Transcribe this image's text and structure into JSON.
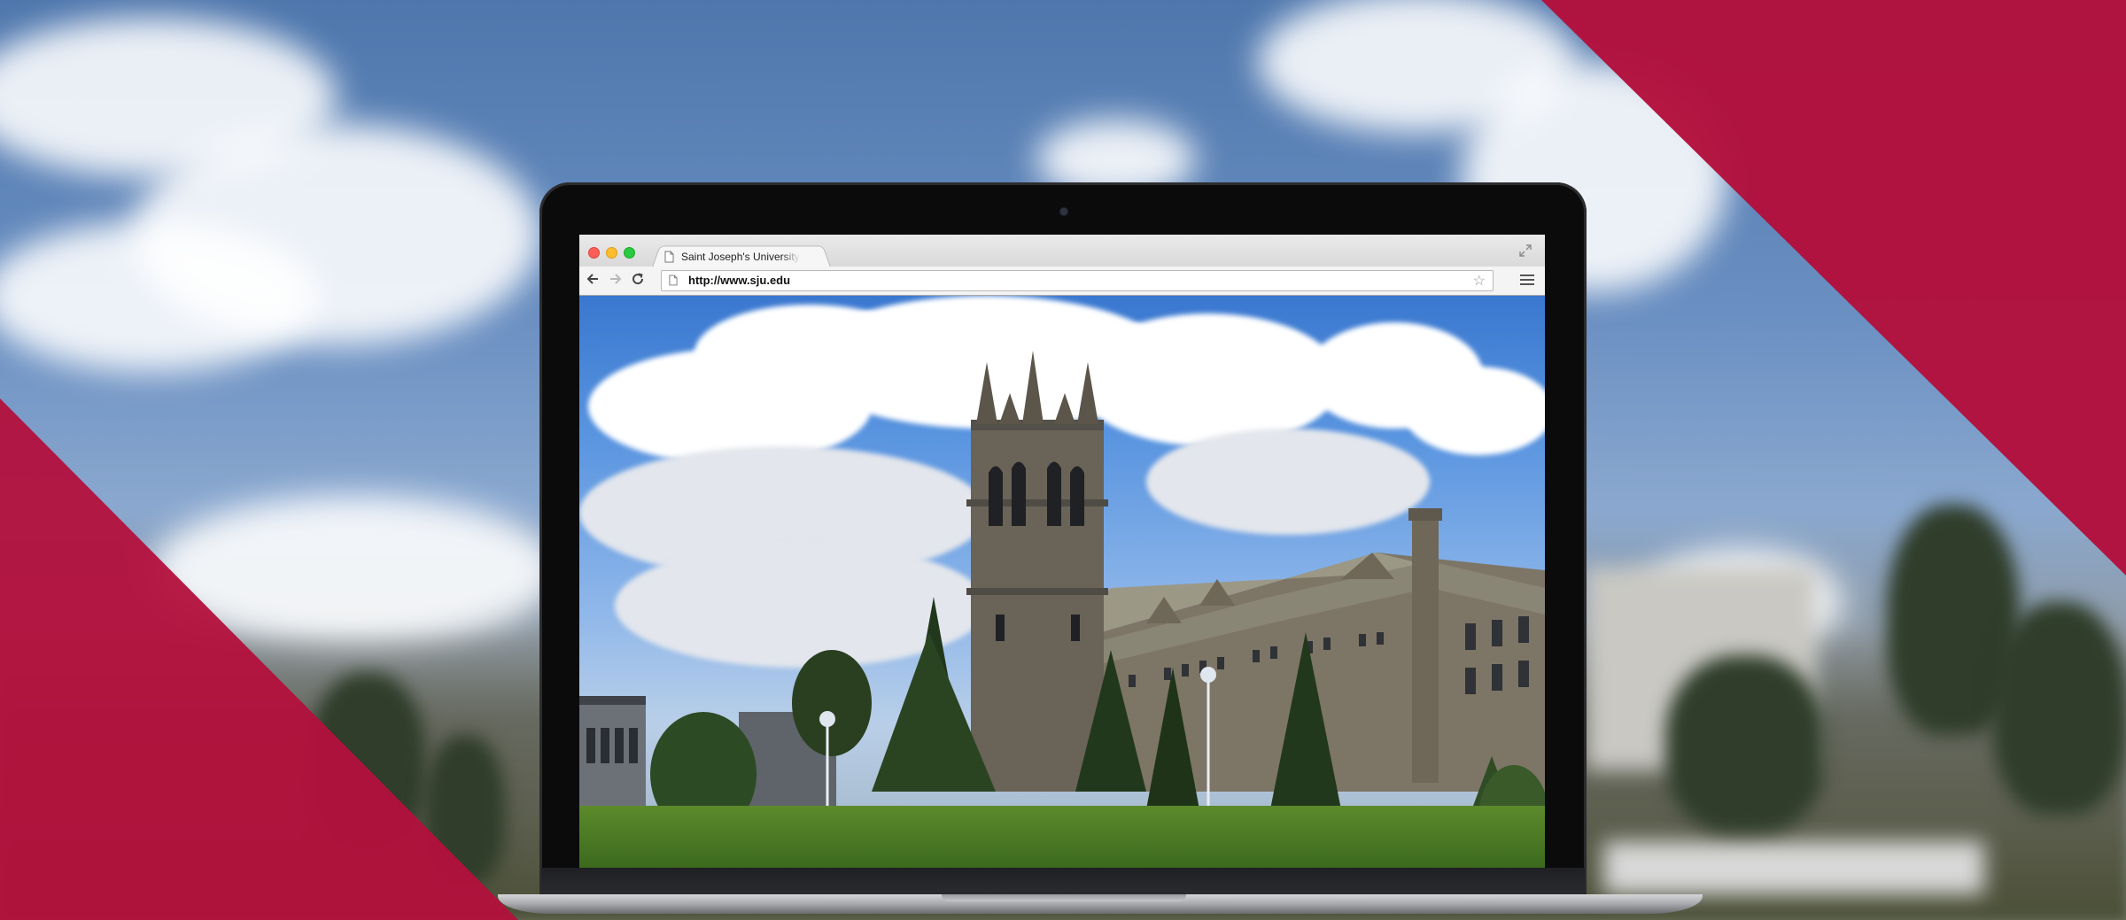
{
  "browser": {
    "tab_title": "Saint Joseph's University",
    "url": "http://www.sju.edu",
    "icons": {
      "close": "traffic-close-icon",
      "minimize": "traffic-minimize-icon",
      "zoom": "traffic-zoom-icon",
      "tab_page": "page-icon",
      "fullscreen": "fullscreen-icon",
      "back": "back-arrow-icon",
      "forward": "forward-arrow-icon",
      "reload": "reload-icon",
      "bookmark": "star-icon",
      "menu": "hamburger-menu-icon"
    }
  },
  "page": {
    "image_subject": "campus-photo"
  },
  "colors": {
    "accent_red": "#b3103c",
    "traffic_close": "#fc5f57",
    "traffic_minimize": "#fdbc2e",
    "traffic_zoom": "#29c940",
    "laptop_bezel": "#0b0b0c"
  }
}
